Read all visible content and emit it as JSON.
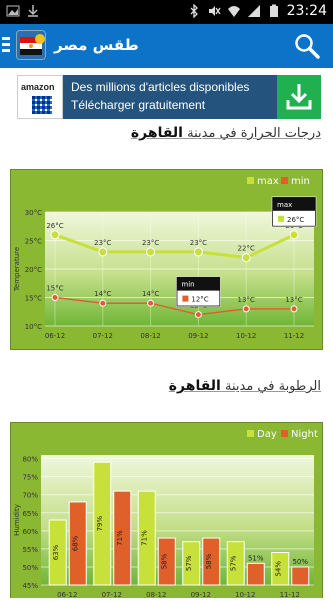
{
  "statusbar": {
    "time": "23:24"
  },
  "appbar": {
    "title": "طقس مصر"
  },
  "ad": {
    "brand": "amazon",
    "line1": "Des millions d'articles disponibles",
    "line2": "Télécharger gratuitement"
  },
  "temperature": {
    "heading_prefix": "درجات الحرارة في مدينة",
    "city": "القاهرة"
  },
  "humidity": {
    "heading_prefix": "الرطوبة في مدينة",
    "city": "القاهرة"
  },
  "chart_data": [
    {
      "type": "line",
      "ylabel": "Temperature",
      "categories": [
        "06-12",
        "07-12",
        "08-12",
        "09-12",
        "10-12",
        "11-12"
      ],
      "yticks": [
        "10°C",
        "15°C",
        "20°C",
        "25°C",
        "30°C"
      ],
      "ylim": [
        10,
        30
      ],
      "legend": [
        "max",
        "min"
      ],
      "colors": {
        "max": "#c8e03a",
        "min": "#e0602a"
      },
      "series": [
        {
          "name": "max",
          "values": [
            26,
            23,
            23,
            23,
            22,
            26
          ],
          "labels": [
            "26°C",
            "23°C",
            "23°C",
            "23°C",
            "22°C",
            "26°C"
          ]
        },
        {
          "name": "min",
          "values": [
            15,
            14,
            14,
            12,
            13,
            13
          ],
          "labels": [
            "15°C",
            "14°C",
            "14°C",
            "12°C",
            "13°C",
            "13°C"
          ]
        }
      ],
      "tooltips": [
        {
          "series": "max",
          "index": 5,
          "title": "max",
          "value": "26°C"
        },
        {
          "series": "min",
          "index": 3,
          "title": "min",
          "value": "12°C"
        }
      ]
    },
    {
      "type": "bar",
      "ylabel": "Humidity",
      "categories": [
        "06-12",
        "07-12",
        "08-12",
        "09-12",
        "10-12",
        "11-12"
      ],
      "yticks": [
        "45%",
        "50%",
        "55%",
        "60%",
        "65%",
        "70%",
        "75%",
        "80%"
      ],
      "ylim": [
        45,
        81
      ],
      "legend": [
        "Day",
        "Night"
      ],
      "colors": {
        "Day": "#c8e03a",
        "Night": "#e0602a"
      },
      "series": [
        {
          "name": "Day",
          "values": [
            63,
            79,
            71,
            57,
            57,
            54
          ],
          "labels": [
            "63%",
            "79%",
            "71%",
            "57%",
            "57%",
            "54%"
          ]
        },
        {
          "name": "Night",
          "values": [
            68,
            71,
            58,
            58,
            51,
            50
          ],
          "labels": [
            "68%",
            "71%",
            "58%",
            "58%",
            "51%",
            "50%"
          ]
        }
      ]
    }
  ]
}
